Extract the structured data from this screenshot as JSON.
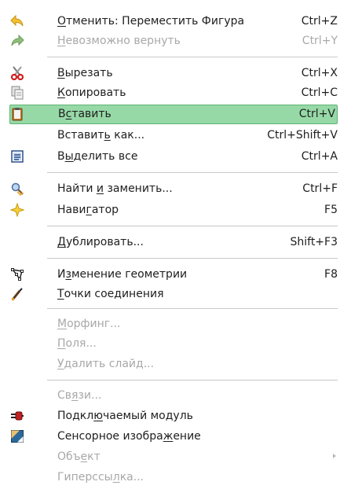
{
  "menu": {
    "items": {
      "undo": {
        "pre": "",
        "ul": "О",
        "post": "тменить: Переместить Фигура",
        "shortcut": "Ctrl+Z"
      },
      "redo": {
        "pre": "",
        "ul": "Н",
        "post": "евозможно вернуть",
        "shortcut": "Ctrl+Y"
      },
      "cut": {
        "pre": "",
        "ul": "В",
        "post": "ырезать",
        "shortcut": "Ctrl+X"
      },
      "copy": {
        "pre": "",
        "ul": "К",
        "post": "опировать",
        "shortcut": "Ctrl+C"
      },
      "paste": {
        "pre": "В",
        "ul": "с",
        "post": "тавить",
        "shortcut": "Ctrl+V"
      },
      "paste_as": {
        "pre": "Вставит",
        "ul": "ь",
        "post": " как...",
        "shortcut": "Ctrl+Shift+V"
      },
      "select_all": {
        "pre": "В",
        "ul": "ы",
        "post": "делить все",
        "shortcut": "Ctrl+A"
      },
      "find_replace": {
        "pre": "Найти ",
        "ul": "и",
        "post": " заменить...",
        "shortcut": "Ctrl+F"
      },
      "navigator": {
        "pre": "Нави",
        "ul": "г",
        "post": "атор",
        "shortcut": "F5"
      },
      "duplicate": {
        "pre": "",
        "ul": "Д",
        "post": "ублировать...",
        "shortcut": "Shift+F3"
      },
      "geometry": {
        "pre": "И",
        "ul": "з",
        "post": "менение геометрии",
        "shortcut": "F8"
      },
      "glue_points": {
        "pre": "",
        "ul": "Т",
        "post": "очки соединения",
        "shortcut": ""
      },
      "morphing": {
        "pre": "",
        "ul": "М",
        "post": "орфинг...",
        "shortcut": ""
      },
      "fields": {
        "pre": "",
        "ul": "П",
        "post": "оля...",
        "shortcut": ""
      },
      "delete_slide": {
        "pre": "",
        "ul": "У",
        "post": "далить слайд...",
        "shortcut": ""
      },
      "links": {
        "pre": "Св",
        "ul": "я",
        "post": "зи...",
        "shortcut": ""
      },
      "plugin": {
        "pre": "Подкл",
        "ul": "ю",
        "post": "чаемый модуль",
        "shortcut": ""
      },
      "image_map": {
        "pre": "Сенсорное изобра",
        "ul": "ж",
        "post": "ение",
        "shortcut": ""
      },
      "object": {
        "pre": "Объ",
        "ul": "е",
        "post": "кт",
        "shortcut": ""
      },
      "hyperlink": {
        "pre": "Гиперссы",
        "ul": "л",
        "post": "ка...",
        "shortcut": ""
      }
    }
  },
  "colors": {
    "highlight_bg": "#96d9a6",
    "highlight_border": "#5fb274",
    "disabled_text": "#a8a8a8",
    "separator": "#c8c8c8"
  },
  "icons": {
    "undo": "undo-arrow-icon",
    "redo": "redo-arrow-icon",
    "cut": "scissors-icon",
    "copy": "copy-icon",
    "paste": "clipboard-icon",
    "select_all": "select-all-icon",
    "find_replace": "find-replace-icon",
    "navigator": "navigator-star-icon",
    "geometry": "edit-points-icon",
    "glue_points": "glue-points-icon",
    "plugin": "plugin-icon",
    "image_map": "image-map-icon"
  }
}
